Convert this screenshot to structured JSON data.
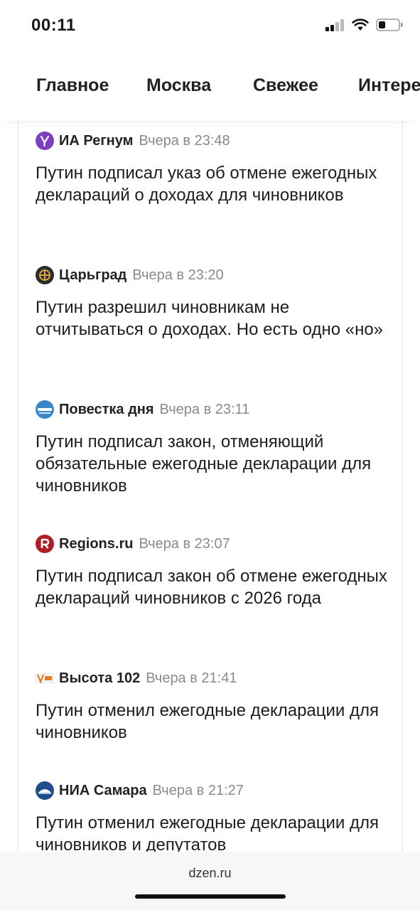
{
  "status": {
    "time": "00:11",
    "signal_icon": "cellular-signal-icon",
    "wifi_icon": "wifi-icon",
    "battery_icon": "battery-icon"
  },
  "tabs": [
    "Главное",
    "Москва",
    "Свежее",
    "Интере"
  ],
  "news": [
    {
      "source": "ИА Регнум",
      "time": "Вчера в 23:48",
      "headline": "Путин подписал указ об отмене ежегодных деклараций о доходах для чиновников",
      "logo": "regnum-logo",
      "logo_color": "#7b3fbf"
    },
    {
      "source": "Царьград",
      "time": "Вчера в 23:20",
      "headline": "Путин разрешил чиновникам не отчитываться о доходах. Но есть одно «но»",
      "logo": "tsargrad-logo",
      "logo_color": "#2b2b2b"
    },
    {
      "source": "Повестка дня",
      "time": "Вчера в 23:11",
      "headline": "Путин подписал закон, отменяющий обязательные ежегодные декларации для чиновников",
      "logo": "povestka-logo",
      "logo_color": "#3a86c8"
    },
    {
      "source": "Regions.ru",
      "time": "Вчера в 23:07",
      "headline": "Путин подписал закон об отмене ежегодных деклараций чиновников с 2026 года",
      "logo": "regions-logo",
      "logo_color": "#b01e24"
    },
    {
      "source": "Высота 102",
      "time": "Вчера в 21:41",
      "headline": "Путин отменил ежегодные декларации для чиновников",
      "logo": "vysota-logo",
      "logo_color": "#e87a1e"
    },
    {
      "source": "НИА Самара",
      "time": "Вчера в 21:27",
      "headline": "Путин отменил ежегодные декларации для чиновников и депутатов",
      "logo": "nia-samara-logo",
      "logo_color": "#1f4e8c"
    }
  ],
  "browser": {
    "url": "dzen.ru"
  }
}
